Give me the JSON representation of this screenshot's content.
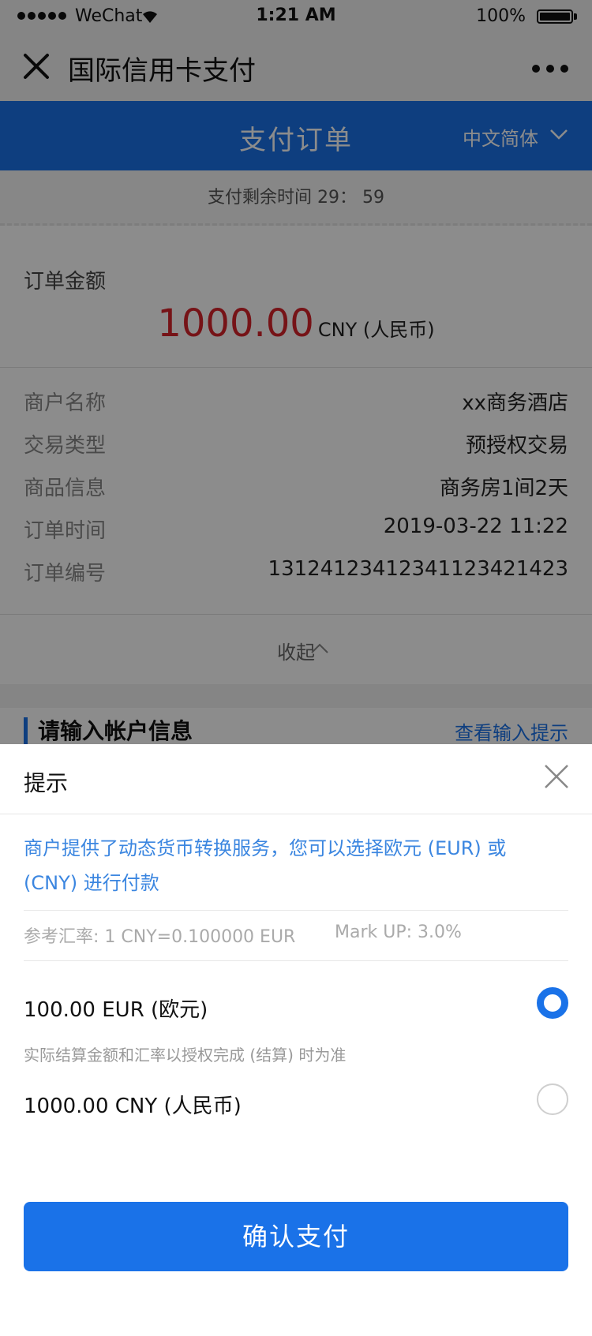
{
  "status_bar": {
    "carrier": "WeChat",
    "time": "1:21 AM",
    "battery": "100%"
  },
  "nav": {
    "title": "国际信用卡支付",
    "close_icon": "close-icon",
    "more_icon": "more-icon"
  },
  "header": {
    "title": "支付订单",
    "language": "中文简体"
  },
  "timer": {
    "text": "支付剩余时间  29： 59"
  },
  "order": {
    "amount_label": "订单金额",
    "amount": "1000.00",
    "currency": "CNY (人民币)",
    "details": [
      {
        "label": "商户名称",
        "value": "xx商务酒店"
      },
      {
        "label": "交易类型",
        "value": "预授权交易"
      },
      {
        "label": "商品信息",
        "value": "商务房1间2天"
      },
      {
        "label": "订单时间",
        "value": "2019-03-22 11:22"
      },
      {
        "label": "订单编号",
        "value": "131241234123411234214​23"
      }
    ],
    "collapse_label": "收起"
  },
  "account": {
    "title": "请输入帐户信息",
    "hint_link": "查看输入提示"
  },
  "sheet": {
    "title": "提示",
    "notice": "商户提供了动态货币转换服务，您可以选择欧元 (EUR) 或 (CNY) 进行付款",
    "rate": "参考汇率: 1 CNY=0.100000 EUR",
    "markup": "Mark UP: 3.0%",
    "options": [
      {
        "label": "100.00 EUR (欧元)",
        "selected": true
      },
      {
        "label": "1000.00 CNY (人民币)",
        "selected": false
      }
    ],
    "option_note": "实际结算金额和汇率以授权完成 (结算) 时为准",
    "confirm_label": "确认支付"
  },
  "colors": {
    "accent": "#1a72e8",
    "amount_red": "#d8232a",
    "notice_blue": "#3b86e0"
  }
}
